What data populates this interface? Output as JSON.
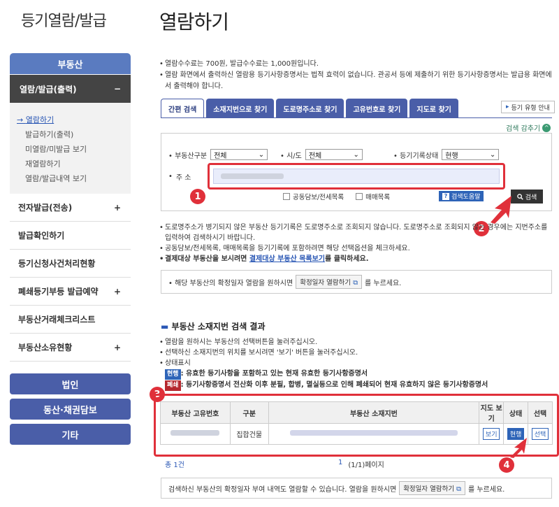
{
  "sidebar": {
    "title": "등기열람/발급",
    "real_estate": "부동산",
    "section_open": "열람/발급(출력)",
    "section_open_icon": "minus-icon",
    "sub_items": [
      "열람하기",
      "발급하기(출력)",
      "미열람/미발급 보기",
      "재열람하기",
      "열람/발급내역 보기"
    ],
    "items": [
      {
        "label": "전자발급(전송)",
        "icon": "+"
      },
      {
        "label": "발급확인하기",
        "icon": ""
      },
      {
        "label": "등기신청사건처리현황",
        "icon": ""
      },
      {
        "label": "폐쇄등기부등 발급예약",
        "icon": "+"
      },
      {
        "label": "부동산거래체크리스트",
        "icon": ""
      },
      {
        "label": "부동산소유현황",
        "icon": "+"
      }
    ],
    "pills": [
      "법인",
      "동산·채권담보",
      "기타"
    ]
  },
  "main": {
    "title": "열람하기",
    "notes": [
      "열람수수료는 700원, 발급수수료는 1,000원입니다.",
      "열람 화면에서 출력하신 열람용 등기사항증명서는 법적 효력이 없습니다. 관공서 등에 제출하기 위한 등기사항증명서는 발급용 화면에서 출력해야 합니다."
    ],
    "tabs": [
      "간편 검색",
      "소재지번으로 찾기",
      "도로명주소로 찾기",
      "고유번호로 찾기",
      "지도로 찾기"
    ],
    "help_button": "등기 유형 안내",
    "collapse_label": "검색 감추기",
    "collapse_icon": "^",
    "search": {
      "type_label": "부동산구분",
      "type_value": "전체",
      "region_label": "시/도",
      "region_value": "전체",
      "status_label": "등기기록상태",
      "status_value": "현행",
      "address_label": "주 소",
      "check1": "공동담보/전세목록",
      "check2": "매매목록",
      "help_label": "검색도움말",
      "search_label": "검색"
    },
    "markers": [
      "1",
      "2",
      "3",
      "4"
    ],
    "notes2": {
      "n1": "도로명주소가 병기되지 않은 부동산 등기기록은 도로명주소로 조회되지 않습니다. 도로명주소로 조회되지 않는 경우에는 지번주소를 입력하여 검색하시기 바랍니다.",
      "n2": "공동담보/전세목록, 매매목록을 등기기록에 포함하려면 해당 선택옵션을 체크하세요.",
      "n3_pre": "결제대상 부동산을 보시려면",
      "n3_link": "결제대상 부동산 목록보기",
      "n3_post": "를 클릭하세요."
    },
    "info_box": {
      "pre": "해당 부동산의 확정일자 열람을 원하시면",
      "button": "확정일자 열람하기",
      "post": "를 누르세요."
    },
    "result": {
      "title": "부동산 소재지번 검색 결과",
      "notes": [
        "열람을 원하시는 부동산의 선택버튼을 눌러주십시오.",
        "선택하신 소재지번의 위치를 보시려면 '보기' 버튼을 눌러주십시오.",
        "상태표시"
      ],
      "status_current_badge": "현행",
      "status_current_text": ": 유효한 등기사항을 포함하고 있는 현재 유효한 등기사항증명서",
      "status_closed_badge": "폐쇄",
      "status_closed_text": ": 등기사항증명서 전산화 이후 분필, 합병, 멸실등으로 인해 폐쇄되어 현재 유효하지 않은 등기사항증명서",
      "table": {
        "headers": [
          "부동산 고유번호",
          "구분",
          "부동산 소재지번",
          "지도 보기",
          "상태",
          "선택"
        ],
        "row": {
          "type": "집합건물",
          "map": "보기",
          "status": "현행",
          "select": "선택"
        }
      },
      "total": "총 1건",
      "page_num": "1",
      "page_info": "(1/1)페이지"
    },
    "bottom_box": {
      "pre": "검색하신 부동산의 확정일자 부여 내역도 열람할 수 있습니다. 열람을 원하시면",
      "button": "확정일자 열람하기",
      "post": "를 누르세요."
    }
  }
}
